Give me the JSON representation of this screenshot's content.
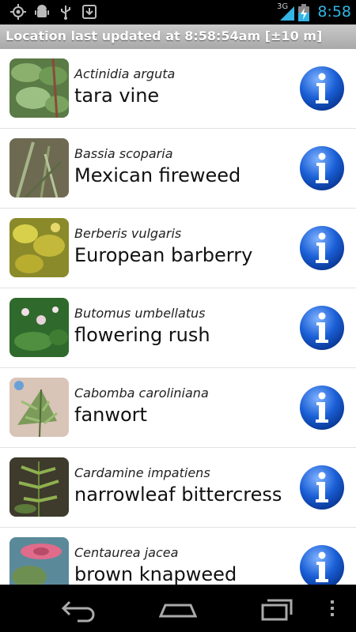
{
  "status_bar": {
    "time": "8:58",
    "network": "3G",
    "icons": [
      "gps-icon",
      "android-debug-icon",
      "usb-icon",
      "download-icon",
      "signal-icon",
      "battery-charging-icon"
    ]
  },
  "location_bar": {
    "text": "Location last updated at 8:58:54am [±10 m]"
  },
  "plants": [
    {
      "scientific": "Actinidia arguta",
      "common": "tara vine"
    },
    {
      "scientific": "Bassia scoparia",
      "common": "Mexican fireweed"
    },
    {
      "scientific": "Berberis vulgaris",
      "common": "European barberry"
    },
    {
      "scientific": "Butomus umbellatus",
      "common": "flowering rush"
    },
    {
      "scientific": "Cabomba caroliniana",
      "common": "fanwort"
    },
    {
      "scientific": "Cardamine impatiens",
      "common": "narrowleaf bittercress"
    },
    {
      "scientific": "Centaurea jacea",
      "common": "brown knapweed"
    }
  ],
  "nav_bar": {
    "buttons": [
      "back-icon",
      "home-icon",
      "recent-apps-icon",
      "menu-overflow-icon"
    ]
  },
  "colors": {
    "accent_time": "#33b5e5",
    "info_button": "#1a5fd6"
  }
}
